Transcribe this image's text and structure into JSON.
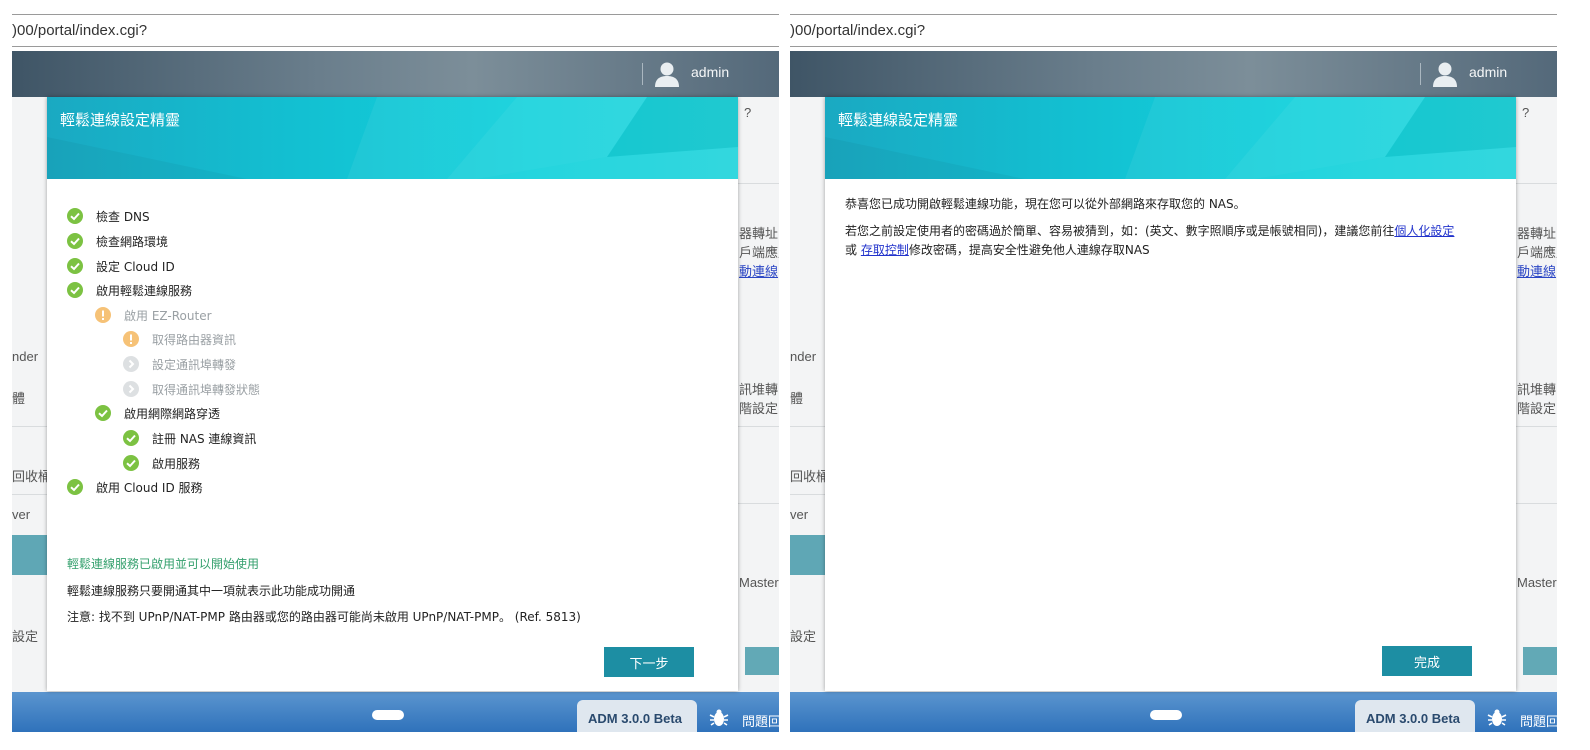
{
  "browser": {
    "url": ")00/portal/index.cgi?"
  },
  "topbar": {
    "username": "admin"
  },
  "background": {
    "side_labels": [
      "nder",
      "體",
      "回收桶",
      "ver",
      "設定"
    ],
    "right_snippets": [
      "器轉址",
      "戶端應用",
      "連線",
      "訊堆轉",
      "階設定",
      "Master"
    ],
    "right_link": "動連線"
  },
  "taskbar": {
    "adm_label": "ADM 3.0.0 Beta",
    "help_label": "問題回報"
  },
  "dialog_left": {
    "title": "輕鬆連線設定精靈",
    "steps": [
      {
        "label": "檢查 DNS",
        "status": "success"
      },
      {
        "label": "檢查網路環境",
        "status": "success"
      },
      {
        "label": "設定 Cloud ID",
        "status": "success"
      },
      {
        "label": "啟用輕鬆連線服務",
        "status": "success"
      },
      {
        "label": "啟用 EZ-Router",
        "status": "warning"
      },
      {
        "label": "取得路由器資訊",
        "status": "warning"
      },
      {
        "label": "設定通訊埠轉發",
        "status": "skipped"
      },
      {
        "label": "取得通訊埠轉發狀態",
        "status": "skipped"
      },
      {
        "label": "啟用網際網路穿透",
        "status": "success"
      },
      {
        "label": "註冊 NAS 連線資訊",
        "status": "success"
      },
      {
        "label": "啟用服務",
        "status": "success"
      },
      {
        "label": "啟用 Cloud ID 服務",
        "status": "success"
      }
    ],
    "success_message": "輕鬆連線服務已啟用並可以開始使用",
    "info_message": "輕鬆連線服務只要開通其中一項就表示此功能成功開通",
    "note_message": "注意: 找不到 UPnP/NAT-PMP 路由器或您的路由器可能尚未啟用 UPnP/NAT-PMP。 (Ref. 5813)",
    "next_button": "下一步"
  },
  "dialog_right": {
    "title": "輕鬆連線設定精靈",
    "line1": "恭喜您已成功開啟輕鬆連線功能，現在您可以從外部網路來存取您的 NAS。",
    "line2_prefix": "若您之前設定使用者的密碼過於簡單、容易被猜到，如：(英文、數字照順序或是帳號相同)，建議您前往",
    "link_personal": "個人化設定",
    "line3_or": "或",
    "link_access": "存取控制",
    "line3_suffix": "修改密碼，提高安全性避免他人連線存取NAS",
    "finish_button": "完成"
  },
  "colors": {
    "success": "#7cc242",
    "warning": "#f4b24a",
    "skipped": "#d6d9db",
    "accent": "#1d8ea3",
    "link": "#2233cc"
  }
}
